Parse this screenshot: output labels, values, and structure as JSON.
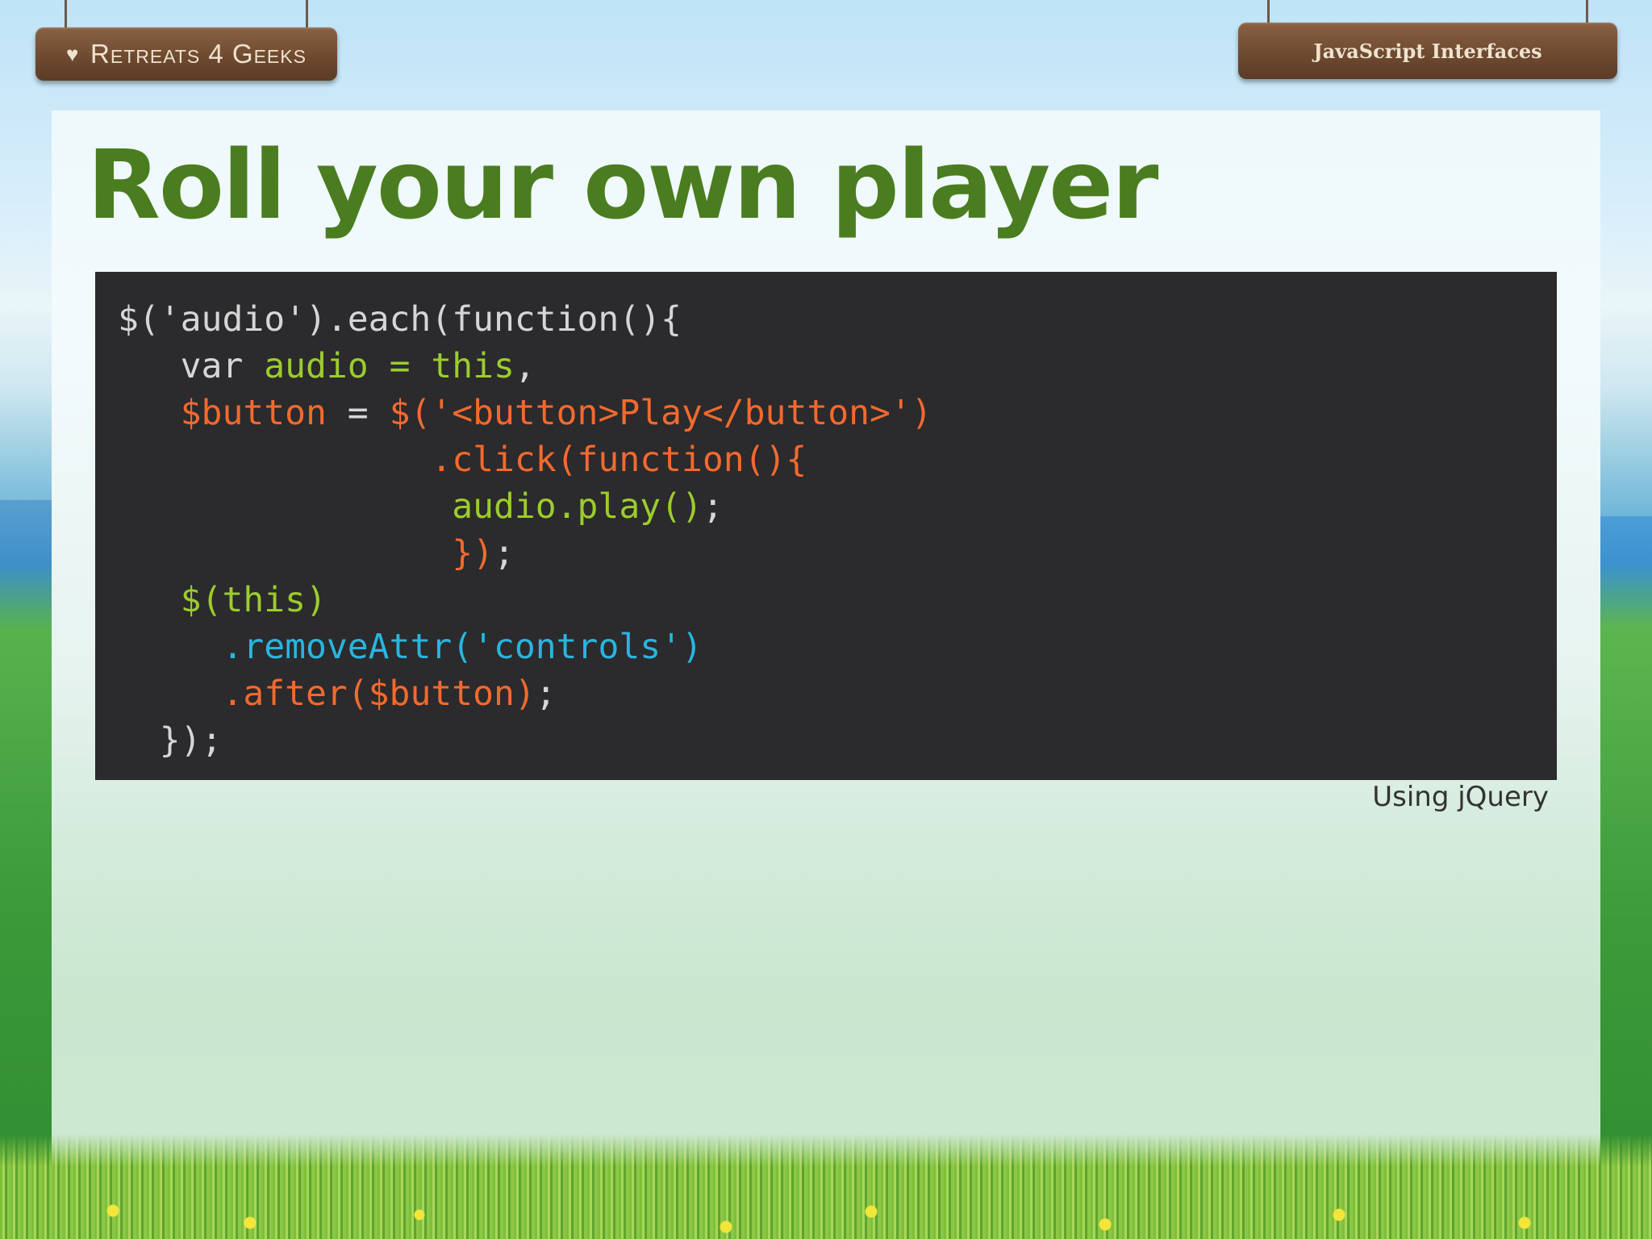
{
  "header": {
    "brand": "Retreats 4 Geeks",
    "brand_icon": "heart-icon",
    "topic": "JavaScript Interfaces"
  },
  "slide": {
    "title": "Roll your own player",
    "caption": "Using jQuery"
  },
  "code": {
    "line1": "$('audio').each(function(){",
    "line2_indent": "   ",
    "line2_var": "var ",
    "line2_audio": "audio = this",
    "line2_comma": ",",
    "line3_indent": "   ",
    "line3_button": "$button",
    "line3_eq": " = ",
    "line3_rest": "$('<button>Play</button>')",
    "line4": "               .click(function(){",
    "line5_indent": "                ",
    "line5_body": "audio.play()",
    "line5_semi": ";",
    "line6_indent": "                ",
    "line6_close": "})",
    "line6_semi": ";",
    "line7_indent": "   ",
    "line7": "$(this)",
    "line8_indent": "     ",
    "line8": ".removeAttr('controls')",
    "line9_indent": "     ",
    "line9": ".after($button)",
    "line9_semi": ";",
    "line10": "  });"
  },
  "colors": {
    "title": "#4a7d1f",
    "code_bg": "#2b2a2c",
    "keyword_green": "#9ccc2c",
    "keyword_orange": "#f26a2e",
    "keyword_cyan": "#27b6de"
  }
}
